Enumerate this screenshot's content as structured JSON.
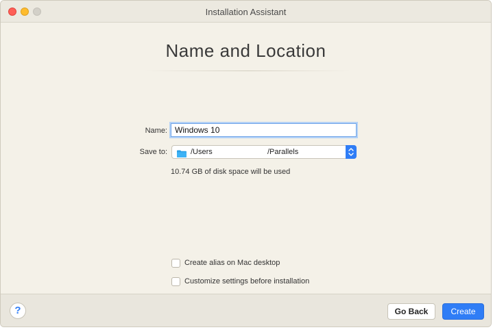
{
  "window": {
    "title": "Installation Assistant"
  },
  "page": {
    "heading": "Name and Location"
  },
  "form": {
    "name_label": "Name:",
    "name_value": "Windows 10",
    "save_label": "Save to:",
    "save_path_prefix": "/Users",
    "save_path_suffix": "/Parallels",
    "folder_icon": "folder-icon",
    "disk_info": "10.74 GB of disk space will be used"
  },
  "options": {
    "alias_label": "Create alias on Mac desktop",
    "alias_checked": false,
    "customize_label": "Customize settings before installation",
    "customize_checked": false
  },
  "footer": {
    "help_label": "?",
    "go_back_label": "Go Back",
    "create_label": "Create"
  },
  "colors": {
    "accent": "#2f7df6",
    "window_bg": "#f4f1e8",
    "close": "#fe5f57",
    "minimize": "#febc2e"
  }
}
